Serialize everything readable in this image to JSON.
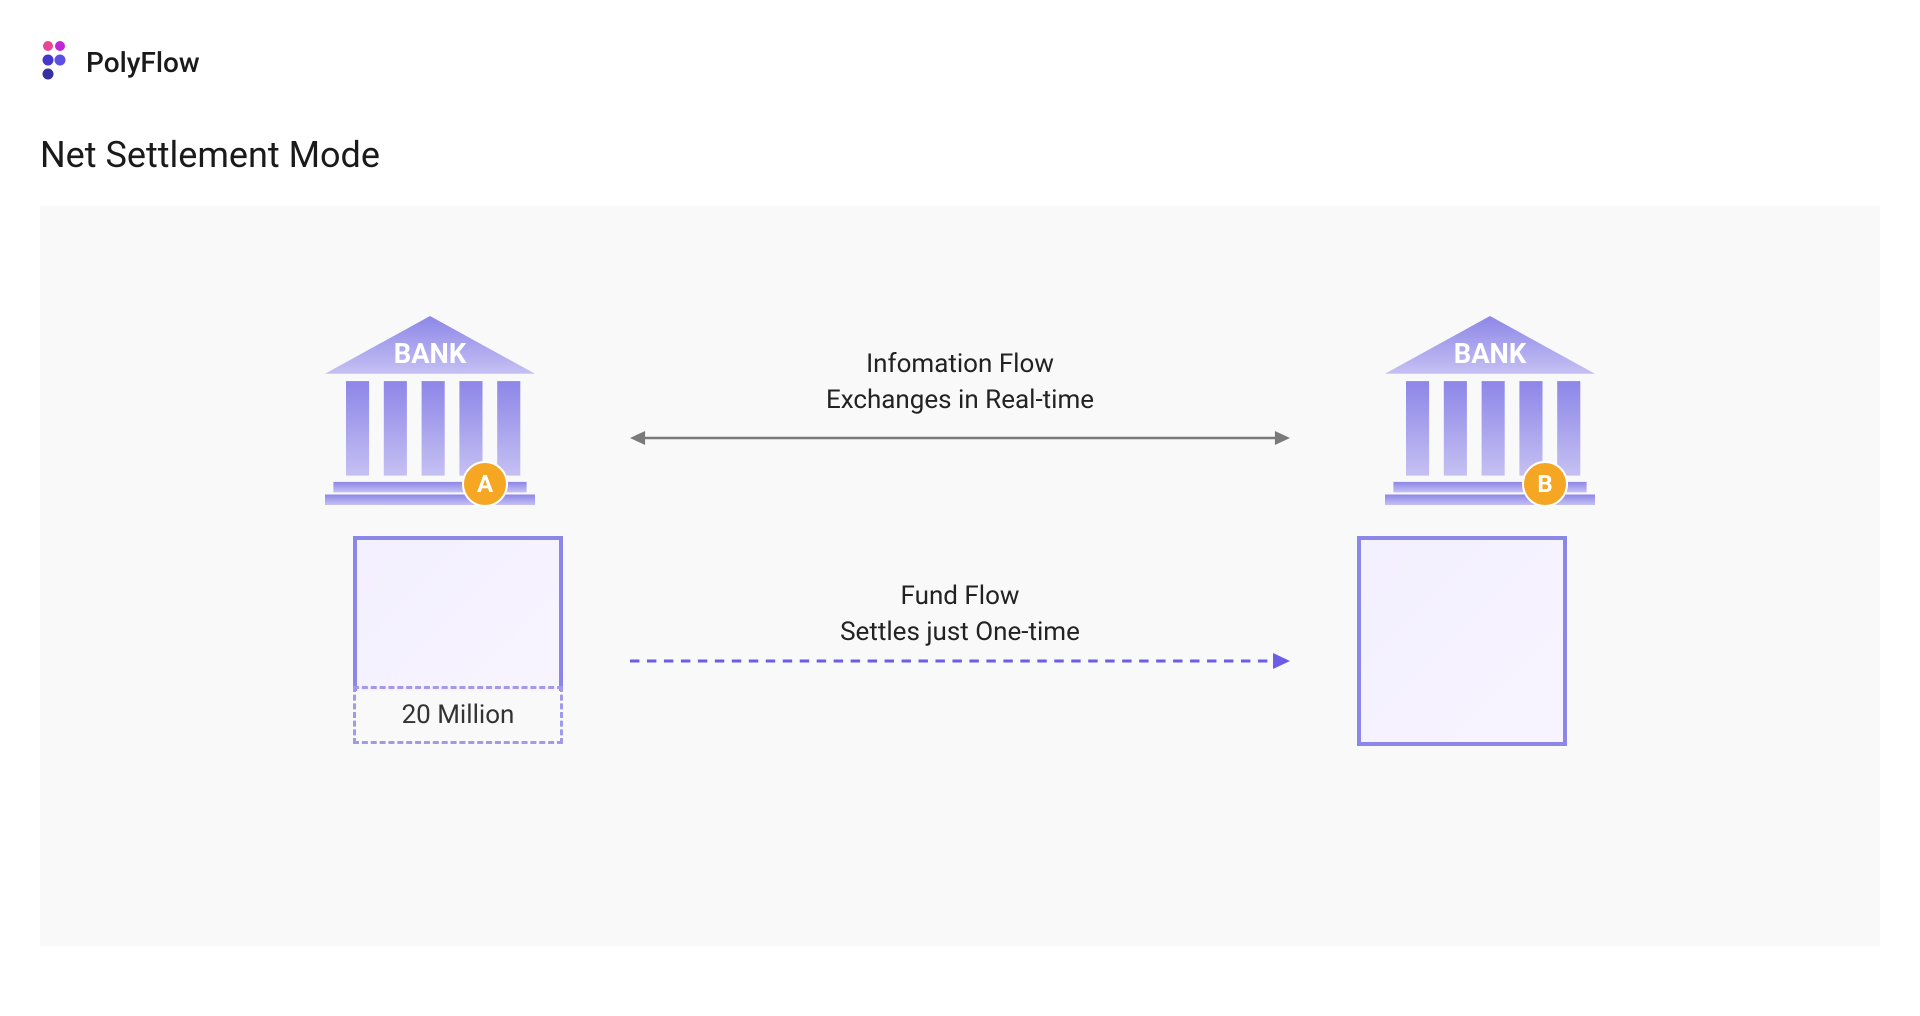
{
  "brand": {
    "name": "PolyFlow"
  },
  "title": "Net Settlement Mode",
  "banks": {
    "label": "BANK",
    "a_badge": "A",
    "b_badge": "B"
  },
  "flows": {
    "info_line1": "Infomation Flow",
    "info_line2": "Exchanges in Real-time",
    "fund_line1": "Fund Flow",
    "fund_line2": "Settles just One-time"
  },
  "amount": "20 Million",
  "colors": {
    "bank_gradient_top": "#8d86e8",
    "bank_gradient_bottom": "#b9b3f0",
    "badge": "#f5a623",
    "arrow_gray": "#7a7a7a",
    "arrow_purple": "#6c5ce7"
  }
}
